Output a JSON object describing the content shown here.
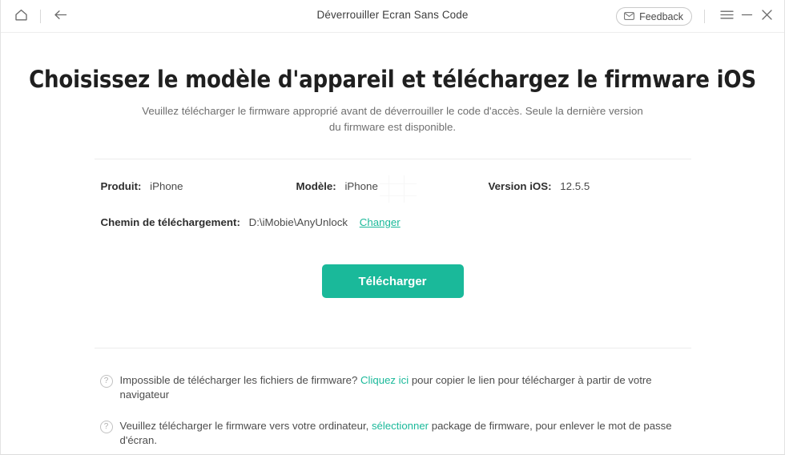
{
  "titlebar": {
    "home_icon": "home-icon",
    "back_icon": "back-arrow-icon",
    "title": "Déverrouiller Ecran Sans Code",
    "feedback_label": "Feedback",
    "feedback_icon": "envelope-icon",
    "menu_icon": "hamburger-menu-icon",
    "minimize_icon": "minimize-icon",
    "close_icon": "close-icon"
  },
  "main": {
    "headline": "Choisissez le modèle d'appareil et téléchargez le firmware iOS",
    "subtitle": "Veuillez télécharger le firmware approprié avant de déverrouiller le code d'accès. Seule la dernière version du firmware est disponible.",
    "info": {
      "product_label": "Produit:",
      "product_value": "iPhone",
      "model_label": "Modèle:",
      "model_value": "iPhone",
      "ios_label": "Version iOS:",
      "ios_value": "12.5.5",
      "path_label": "Chemin de téléchargement:",
      "path_value": "D:\\iMobie\\AnyUnlock",
      "change_link": "Changer"
    },
    "download_button": "Télécharger"
  },
  "help": {
    "icon": "question-circle-icon",
    "line1": {
      "before": "Impossible de télécharger les fichiers de firmware?",
      "link": "Cliquez ici",
      "after": "pour copier le lien pour télécharger à partir de votre navigateur"
    },
    "line2": {
      "before": "Veuillez télécharger le firmware vers votre ordinateur,",
      "link": "sélectionner",
      "after": "package de firmware, pour enlever le mot de passe d'écran."
    }
  },
  "colors": {
    "accent": "#1ab99a",
    "link": "#1bb99a",
    "text": "#3a3a3a",
    "muted": "#6f6f6f",
    "divider": "#ececec"
  }
}
